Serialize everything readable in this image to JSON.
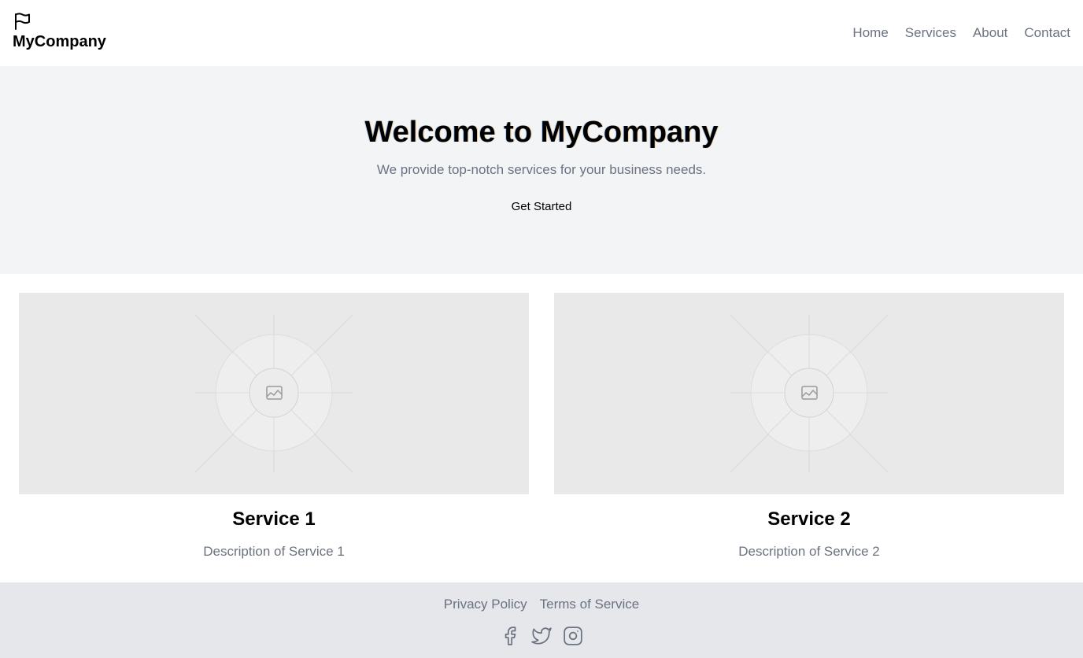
{
  "header": {
    "brand_name": "MyCompany",
    "brand_icon": "flag-icon",
    "nav": [
      {
        "label": "Home"
      },
      {
        "label": "Services"
      },
      {
        "label": "About"
      },
      {
        "label": "Contact"
      }
    ]
  },
  "hero": {
    "title": "Welcome to MyCompany",
    "subtitle": "We provide top-notch services for your business needs.",
    "cta_label": "Get Started"
  },
  "services": [
    {
      "title": "Service 1",
      "description": "Description of Service 1",
      "image_icon": "image-placeholder-icon"
    },
    {
      "title": "Service 2",
      "description": "Description of Service 2",
      "image_icon": "image-placeholder-icon"
    }
  ],
  "footer": {
    "links": [
      {
        "label": "Privacy Policy"
      },
      {
        "label": "Terms of Service"
      }
    ],
    "social": [
      {
        "icon": "facebook-icon"
      },
      {
        "icon": "twitter-icon"
      },
      {
        "icon": "instagram-icon"
      }
    ]
  },
  "colors": {
    "hero_bg": "#f3f4f6",
    "footer_bg": "#e5e7eb",
    "muted_text": "#6b7280",
    "placeholder_bg": "#e9e9e9"
  }
}
